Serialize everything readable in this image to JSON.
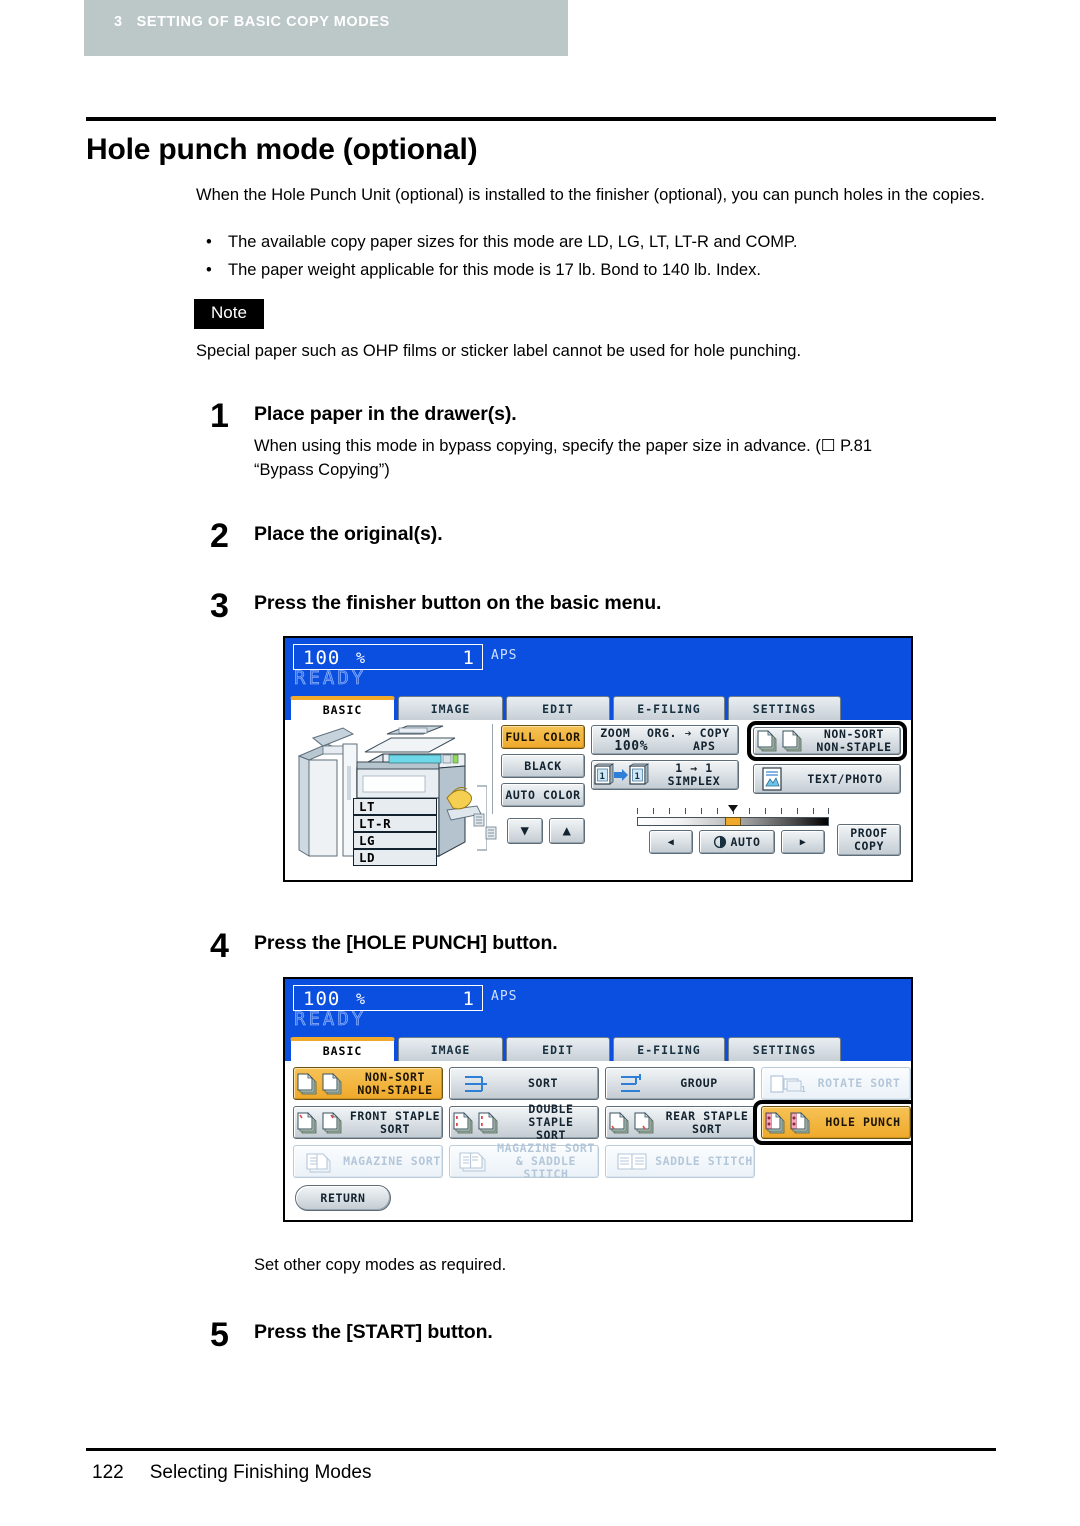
{
  "header": {
    "chapter_number": "3",
    "chapter_title": "SETTING OF BASIC COPY MODES",
    "band_color": "#bcc7c7"
  },
  "page_title": "Hole punch mode (optional)",
  "intro": "When the Hole Punch Unit (optional) is installed to the finisher (optional), you can punch holes in the copies.",
  "bullets": [
    "The available copy paper sizes for this mode are LD, LG, LT, LT-R and COMP.",
    "The paper weight applicable for this mode is 17 lb. Bond to 140 lb. Index."
  ],
  "note": {
    "tag": "Note",
    "text": "Special paper such as OHP films or sticker label cannot be used for hole punching."
  },
  "steps": [
    {
      "number": "1",
      "heading": "Place paper in the drawer(s).",
      "body_line1": "When using this mode in bypass copying, specify the paper size in advance. (☐ P.81",
      "body_line2": "“Bypass Copying”)"
    },
    {
      "number": "2",
      "heading": "Place the original(s)."
    },
    {
      "number": "3",
      "heading": "Press the finisher button on the basic menu."
    },
    {
      "number": "4",
      "heading": "Press the [HOLE PUNCH] button."
    },
    {
      "number": "5",
      "heading": "Press the [START] button."
    }
  ],
  "interstitial_text": "Set other copy modes as required.",
  "screen_basic": {
    "ratio": "100",
    "percent_symbol": "%",
    "copy_count": "1",
    "paper_mode": "APS",
    "status": "READY",
    "tabs": [
      {
        "label": "BASIC",
        "active": true
      },
      {
        "label": "IMAGE",
        "active": false
      },
      {
        "label": "EDIT",
        "active": false
      },
      {
        "label": "E-FILING",
        "active": false
      },
      {
        "label": "SETTINGS",
        "active": false
      }
    ],
    "drawers": [
      "LT",
      "LT-R",
      "LG",
      "LD"
    ],
    "color_buttons": [
      {
        "label": "FULL COLOR",
        "selected": true
      },
      {
        "label": "BLACK",
        "selected": false
      },
      {
        "label": "AUTO COLOR",
        "selected": false
      }
    ],
    "zoom_button": {
      "zoom_label": "ZOOM",
      "zoom_value": "100%",
      "org_copy_label": "ORG. ➔ COPY",
      "org_copy_value": "APS"
    },
    "duplex_button": {
      "line1": "1 → 1",
      "line2": "SIMPLEX"
    },
    "finisher_button": {
      "line1": "NON-SORT",
      "line2": "NON-STAPLE",
      "focused": true
    },
    "original_mode_button": {
      "label": "TEXT/PHOTO"
    },
    "density": {
      "auto_label": "AUTO",
      "left_arrow": "◀",
      "right_arrow": "▶"
    },
    "proof_copy_button": {
      "line1": "PROOF",
      "line2": "COPY"
    },
    "updown": {
      "down": "▼",
      "up": "▲"
    }
  },
  "screen_finisher": {
    "ratio": "100",
    "percent_symbol": "%",
    "copy_count": "1",
    "paper_mode": "APS",
    "status": "READY",
    "tabs": [
      {
        "label": "BASIC",
        "active": true
      },
      {
        "label": "IMAGE",
        "active": false
      },
      {
        "label": "EDIT",
        "active": false
      },
      {
        "label": "E-FILING",
        "active": false
      },
      {
        "label": "SETTINGS",
        "active": false
      }
    ],
    "modes": [
      {
        "line1": "NON-SORT",
        "line2": "NON-STAPLE",
        "state": "selected",
        "icon": "two-sheets-icon"
      },
      {
        "line1": "SORT",
        "line2": "",
        "state": "normal",
        "icon": "sort-icon"
      },
      {
        "line1": "GROUP",
        "line2": "",
        "state": "normal",
        "icon": "group-icon"
      },
      {
        "line1": "ROTATE SORT",
        "line2": "",
        "state": "disabled",
        "icon": "rotate-sort-icon"
      },
      {
        "line1": "FRONT STAPLE",
        "line2": "SORT",
        "state": "normal",
        "icon": "front-staple-icon"
      },
      {
        "line1": "DOUBLE STAPLE",
        "line2": "SORT",
        "state": "normal",
        "icon": "double-staple-icon"
      },
      {
        "line1": "REAR  STAPLE",
        "line2": "SORT",
        "state": "normal",
        "icon": "rear-staple-icon"
      },
      {
        "line1": "HOLE PUNCH",
        "line2": "",
        "state": "selected",
        "icon": "hole-punch-icon",
        "focused": true
      },
      {
        "line1": "MAGAZINE SORT",
        "line2": "",
        "state": "disabled",
        "icon": "magazine-sort-icon"
      },
      {
        "line1": "MAGAZINE SORT",
        "line2": "& SADDLE STITCH",
        "state": "disabled",
        "icon": "magazine-saddle-icon"
      },
      {
        "line1": "SADDLE  STITCH",
        "line2": "",
        "state": "disabled",
        "icon": "saddle-stitch-icon"
      }
    ],
    "return_button": "RETURN"
  },
  "footer": {
    "page_number": "122",
    "section": "Selecting Finishing Modes"
  },
  "colors": {
    "lcd_background": "#0b4fe0",
    "selected_button": "#efa92b",
    "chapter_band": "#bcc7c7",
    "tab_active_accent": "#f0a92a"
  }
}
